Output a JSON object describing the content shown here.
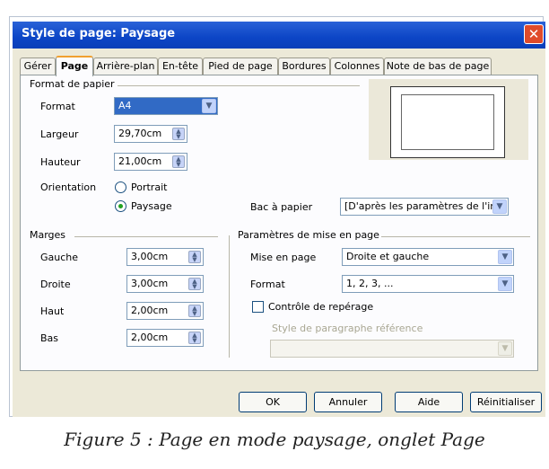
{
  "window": {
    "title": "Style de page: Paysage",
    "close": "✕"
  },
  "tabs": [
    {
      "label": "Gérer"
    },
    {
      "label": "Page"
    },
    {
      "label": "Arrière-plan"
    },
    {
      "label": "En-tête"
    },
    {
      "label": "Pied de page"
    },
    {
      "label": "Bordures"
    },
    {
      "label": "Colonnes"
    },
    {
      "label": "Note de bas de page"
    }
  ],
  "paper": {
    "section_title": "Format de papier",
    "format_label": "Format",
    "format_value": "A4",
    "width_label": "Largeur",
    "width_value": "29,70cm",
    "height_label": "Hauteur",
    "height_value": "21,00cm",
    "orientation_label": "Orientation",
    "portrait_label": "Portrait",
    "landscape_label": "Paysage",
    "tray_label": "Bac à papier",
    "tray_value": "[D'après les paramètres de l'ir"
  },
  "margins": {
    "section_title": "Marges",
    "left_label": "Gauche",
    "left_value": "3,00cm",
    "right_label": "Droite",
    "right_value": "3,00cm",
    "top_label": "Haut",
    "top_value": "2,00cm",
    "bottom_label": "Bas",
    "bottom_value": "2,00cm"
  },
  "layout": {
    "section_title": "Paramètres de mise en page",
    "layout_label": "Mise en page",
    "layout_value": "Droite et gauche",
    "format_label": "Format",
    "format_value": "1, 2, 3, ...",
    "register_label": "Contrôle de repérage",
    "ref_style_label": "Style de paragraphe référence"
  },
  "buttons": {
    "ok": "OK",
    "cancel": "Annuler",
    "help": "Aide",
    "reset": "Réinitialiser"
  },
  "caption": "Figure 5 : Page en mode paysage, onglet Page",
  "colors": {
    "titlebar": "#0c45c6",
    "dialog_bg": "#ece9d8",
    "tab_active_accent": "#f0a030",
    "selection": "#316ac5"
  }
}
